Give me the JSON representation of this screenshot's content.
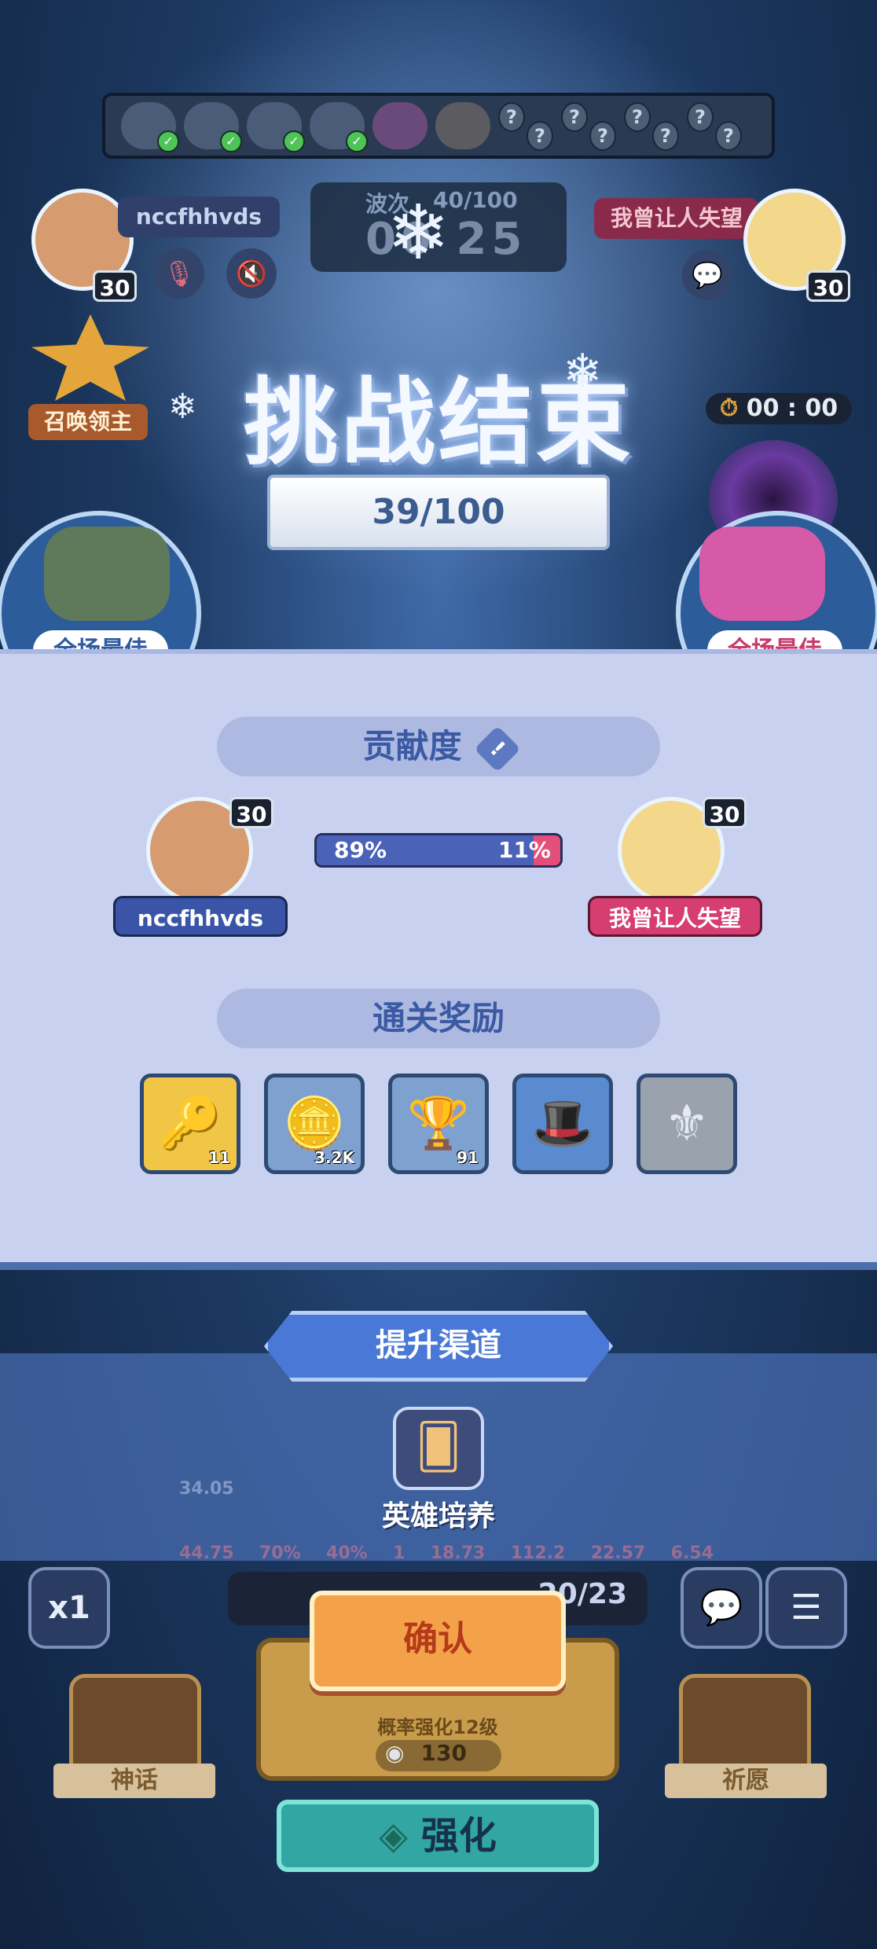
{
  "top": {
    "wave_label": "波次",
    "wave_progress": "40/100",
    "timer": "00 25",
    "boss_icons": [
      "boss-1",
      "boss-2",
      "boss-3",
      "boss-4",
      "boss-5",
      "boss-6"
    ],
    "locked_marks": [
      "?",
      "?",
      "?",
      "?",
      "?",
      "?",
      "?",
      "?"
    ]
  },
  "players": {
    "p1": {
      "name": "nccfhhvds",
      "level": "30"
    },
    "p2": {
      "name": "我曾让人失望",
      "level": "30"
    }
  },
  "summon_leader": {
    "label": "召唤领主"
  },
  "countdown": "00 : 00",
  "result": {
    "title": "挑战结束",
    "score": "39/100",
    "mvp_left": "全场最佳",
    "mvp_right": "全场最佳"
  },
  "contribution": {
    "title": "贡献度",
    "info_icon": "!",
    "p1_share": 89,
    "p1_label": "89%",
    "p2_label": "11%",
    "p1_name": "nccfhhvds",
    "p2_name": "我曾让人失望",
    "level": "30"
  },
  "rewards": {
    "title": "通关奖励",
    "items": [
      {
        "icon": "key-icon",
        "glyph": "🔑",
        "count": "11",
        "bg": "#f1c646"
      },
      {
        "icon": "gold-coin-icon",
        "glyph": "🪙",
        "count": "3.2K",
        "bg": "#7fa1cf"
      },
      {
        "icon": "trophy-icon",
        "glyph": "🏆",
        "count": "91",
        "bg": "#7fa1cf"
      },
      {
        "icon": "hat-emblem-icon",
        "glyph": "🎩",
        "count": "",
        "bg": "#5a8bd0"
      },
      {
        "icon": "silver-emblem-icon",
        "glyph": "⚜",
        "count": "",
        "bg": "#9aa2ad"
      }
    ]
  },
  "channel": {
    "title": "提升渠道",
    "hero_label": "英雄培养",
    "faded_stats": [
      "34.05",
      "44.75",
      "70%",
      "40%",
      "1",
      "18.73",
      "112.2",
      "22.57",
      "6.54"
    ]
  },
  "bottom": {
    "speed": "x1",
    "confirm": "确认",
    "counter": "20/23",
    "summon_desc": "概率强化12级",
    "summon_cost": "130",
    "upgrade": "强化",
    "myth": "神话",
    "pray": "祈愿"
  }
}
